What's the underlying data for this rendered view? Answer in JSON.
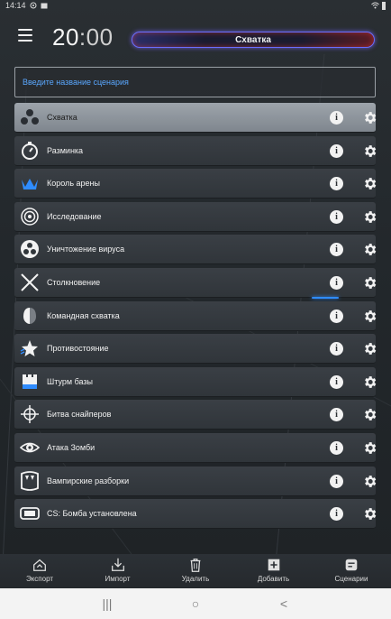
{
  "status_bar": {
    "time": "14:14"
  },
  "header": {
    "timer_minutes": "20",
    "timer_colon": ":",
    "timer_seconds": "00",
    "current_mode": "Схватка"
  },
  "search": {
    "placeholder": "Введите название сценария",
    "value": ""
  },
  "scenarios": [
    {
      "label": "Схватка",
      "icon": "people-group-icon"
    },
    {
      "label": "Разминка",
      "icon": "stopwatch-icon"
    },
    {
      "label": "Король арены",
      "icon": "crown-icon"
    },
    {
      "label": "Исследование",
      "icon": "target-rings-icon"
    },
    {
      "label": "Уничтожение вируса",
      "icon": "biohazard-icon"
    },
    {
      "label": "Столкновение",
      "icon": "crossed-swords-icon"
    },
    {
      "label": "Командная схватка",
      "icon": "split-helmet-icon"
    },
    {
      "label": "Противостояние",
      "icon": "star-burst-icon"
    },
    {
      "label": "Штурм базы",
      "icon": "fortress-icon"
    },
    {
      "label": "Битва снайперов",
      "icon": "crosshair-icon"
    },
    {
      "label": "Атака Зомби",
      "icon": "eye-icon"
    },
    {
      "label": "Вампирские разборки",
      "icon": "fangs-icon"
    },
    {
      "label": "CS: Бомба установлена",
      "icon": "bomb-icon"
    }
  ],
  "row_buttons": {
    "info_glyph": "i"
  },
  "toolbar": {
    "export": "Экспорт",
    "import": "Импорт",
    "delete": "Удалить",
    "add": "Добавить",
    "scenarios": "Сценарии"
  },
  "nav": {
    "recents": "|||",
    "home": "○",
    "back": "<"
  },
  "colors": {
    "accent": "#2f8cff",
    "placeholder": "#5aa8ff",
    "row": "#3a3f45",
    "row_selected": "#9da4ab"
  }
}
